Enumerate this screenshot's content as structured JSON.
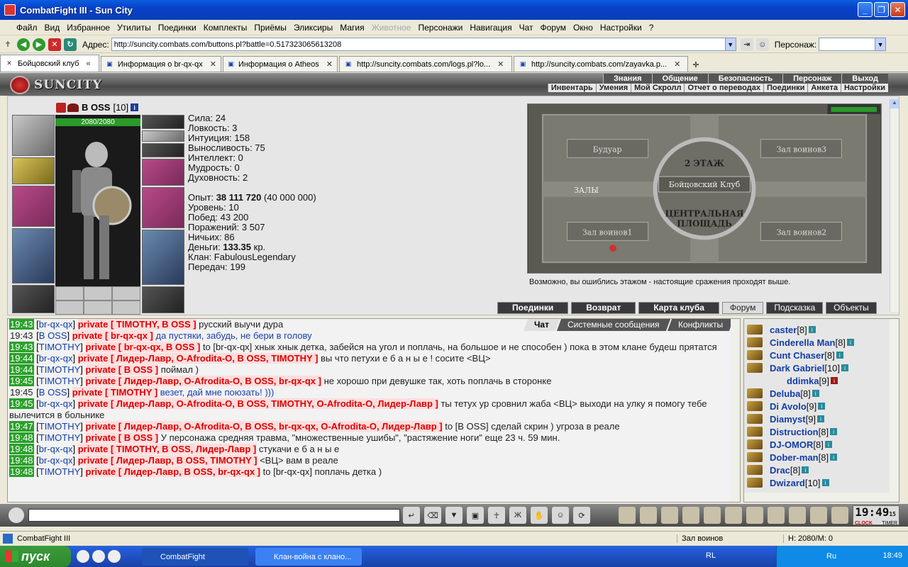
{
  "window": {
    "title": "CombatFight III - Sun City"
  },
  "menu": [
    "Файл",
    "Вид",
    "Избранное",
    "Утилиты",
    "Поединки",
    "Комплекты",
    "Приёмы",
    "Эликсиры",
    "Магия",
    "Животное",
    "Персонажи",
    "Навигация",
    "Чат",
    "Форум",
    "Окно",
    "Настройки",
    "?"
  ],
  "menu_disabled": [
    "Животное"
  ],
  "address": {
    "label": "Адрес:",
    "url": "http://suncity.combats.com/buttons.pl?battle=0.517323065613208",
    "persona_label": "Персонаж:"
  },
  "tabs": [
    {
      "label": "Бойцовский клуб",
      "active": true
    },
    {
      "label": "Информация о br-qx-qx",
      "active": false
    },
    {
      "label": "Информация о Atheos",
      "active": false
    },
    {
      "label": "http://suncity.combats.com/logs.pl?lo...",
      "active": false
    },
    {
      "label": "http://suncity.combats.com/zayavka.p...",
      "active": false
    }
  ],
  "game": {
    "logo": "SUNCITY",
    "nav_top": [
      "Знания",
      "Общение",
      "Безопасность",
      "Персонаж",
      "Выход"
    ],
    "nav_sub": [
      "Инвентарь",
      "Умения",
      "Мой Скролл",
      "Отчет о переводах",
      "Поединки",
      "Анкета",
      "Настройки"
    ]
  },
  "character": {
    "name": "B OSS",
    "level": "[10]",
    "hp": "2080/2080",
    "stats": [
      "Сила: 24",
      "Ловкость: 3",
      "Интуиция: 158",
      "Выносливость: 75",
      "Интеллект: 0",
      "Мудрость: 0",
      "Духовность: 2"
    ],
    "exp_label": "Опыт:",
    "exp_value": "38 111 720",
    "exp_next": "(40 000 000)",
    "level_line": "Уровень: 10",
    "wins": "Побед: 43 200",
    "losses": "Поражений: 3 507",
    "draws": "Ничьих: 86",
    "money_label": "Деньги:",
    "money_value": "133.35",
    "money_unit": "кр.",
    "clan": "Клан: FabulousLegendary",
    "transfers": "Передач: 199"
  },
  "map": {
    "rooms": [
      "Будуар",
      "Зал воинов3",
      "2 ЭТАЖ",
      "Бойцовский Клуб",
      "ЗАЛЫ",
      "ЦЕНТРАЛЬНАЯ",
      "ПЛОЩАДЬ",
      "Зал воинов1",
      "Зал воинов2"
    ],
    "hint": "Возможно, вы ошиблись этажом - настоящие сражения проходят выше."
  },
  "main_buttons": [
    "Поединки",
    "Возврат",
    "Карта клуба",
    "Форум",
    "Подсказка",
    "Объекты"
  ],
  "chat_tabs": [
    {
      "label": "Чат",
      "active": true
    },
    {
      "label": "Системные сообщения",
      "active": false
    },
    {
      "label": "Конфликты",
      "active": false
    }
  ],
  "chat": [
    {
      "time": "19:43",
      "timeStyle": "green",
      "user": "br-qx-qx",
      "priv": "private [ TIMOTHY, B OSS ]",
      "text": " русский выучи дура",
      "blue": false
    },
    {
      "time": "19:43",
      "timeStyle": "plain",
      "user": "B OSS",
      "priv": "private [ br-qx-qx ]",
      "text": " да пустяки, забудь, не бери в голову",
      "blue": true
    },
    {
      "time": "19:43",
      "timeStyle": "green",
      "user": "TIMOTHY",
      "priv": "private [ br-qx-qx, B OSS ]",
      "text": " to [br-qx-qx] хнык хнык детка, забейся на угол и поплачь, на большое и не способен ) пока в этом клане будеш прятатся",
      "blue": false
    },
    {
      "time": "19:44",
      "timeStyle": "green",
      "user": "br-qx-qx",
      "priv": "private [ Лидер-Лавр, O-Afrodita-O, B OSS, TIMOTHY ]",
      "text": " вы что петухи е б а н ы е ! сосите <ВЦ>",
      "blue": false
    },
    {
      "time": "19:44",
      "timeStyle": "green",
      "user": "TIMOTHY",
      "priv": "private [ B OSS ]",
      "text": " поймал )",
      "blue": false
    },
    {
      "time": "19:45",
      "timeStyle": "green",
      "user": "TIMOTHY",
      "priv": "private [ Лидер-Лавр, O-Afrodita-O, B OSS, br-qx-qx ]",
      "text": " не хорошо при девушке так, хоть поплачь в сторонке",
      "blue": false
    },
    {
      "time": "19:45",
      "timeStyle": "plain",
      "user": "B OSS",
      "priv": "private [ TIMOTHY ]",
      "text": " везет, дай мне поюзать! )))",
      "blue": true
    },
    {
      "time": "19:45",
      "timeStyle": "green",
      "user": "br-qx-qx",
      "priv": "private [ Лидер-Лавр, O-Afrodita-O, B OSS, TIMOTHY, O-Afrodita-O, Лидер-Лавр ]",
      "text": " ты тетух ур сровнил жаба <ВЦ> выходи на улку я помогу тебе вылечится в больнике",
      "blue": false
    },
    {
      "time": "19:47",
      "timeStyle": "green",
      "user": "TIMOTHY",
      "priv": "private [ Лидер-Лавр, O-Afrodita-O, B OSS, br-qx-qx, O-Afrodita-O, Лидер-Лавр ]",
      "text": " to [B OSS] сделай скрин ) угроза в реале",
      "blue": false
    },
    {
      "time": "19:48",
      "timeStyle": "green",
      "user": "TIMOTHY",
      "priv": "private [ B OSS ]",
      "text": " У персонажа средняя травма, \"множественные ушибы\", \"растяжение ноги\" еще 23 ч. 59 мин.",
      "blue": false
    },
    {
      "time": "19:48",
      "timeStyle": "green",
      "user": "br-qx-qx",
      "priv": "private [ TIMOTHY, B OSS, Лидер-Лавр ]",
      "text": " стукачи е б а н ы е",
      "blue": false
    },
    {
      "time": "19:48",
      "timeStyle": "green",
      "user": "br-qx-qx",
      "priv": "private [ Лидер-Лавр, B OSS, TIMOTHY ]",
      "text": " <ВЦ> вам в реале",
      "blue": false
    },
    {
      "time": "19:48",
      "timeStyle": "green",
      "user": "TIMOTHY",
      "priv": "private [ Лидер-Лавр, B OSS, br-qx-qx ]",
      "text": " to [br-qx-qx] поплачь детка )",
      "blue": false
    }
  ],
  "users": [
    {
      "name": "caster",
      "level": "[8]",
      "badge": "i",
      "indent": false
    },
    {
      "name": "Cinderella Man",
      "level": "[8]",
      "badge": "i",
      "indent": false
    },
    {
      "name": "Cunt Chaser",
      "level": "[8]",
      "badge": "i",
      "indent": false
    },
    {
      "name": "Dark Gabriel",
      "level": "[10]",
      "badge": "i",
      "indent": false
    },
    {
      "name": "ddimka",
      "level": "[9]",
      "badge": "i",
      "indent": true,
      "red": true
    },
    {
      "name": "Deluba",
      "level": "[8]",
      "badge": "i",
      "indent": false
    },
    {
      "name": "Di Avolo",
      "level": "[9]",
      "badge": "i",
      "indent": false
    },
    {
      "name": "Diamyst",
      "level": "[9]",
      "badge": "i",
      "indent": false
    },
    {
      "name": "Distruction",
      "level": "[8]",
      "badge": "i",
      "indent": false
    },
    {
      "name": "DJ-OMOR",
      "level": "[8]",
      "badge": "i",
      "indent": false
    },
    {
      "name": "Dober-man",
      "level": "[8]",
      "badge": "i",
      "indent": false
    },
    {
      "name": "Drac",
      "level": "[8]",
      "badge": "i",
      "indent": false
    },
    {
      "name": "Dwizard",
      "level": "[10]",
      "badge": "i",
      "indent": false
    }
  ],
  "clock": {
    "time": "19:49",
    "sec": "15",
    "labels": [
      "CLOCK",
      "TIMER"
    ]
  },
  "statusbar": {
    "text": "CombatFight III",
    "zone": "Зал воинов",
    "hp": "H: 2080/M: 0"
  },
  "taskbar": {
    "start": "пуск",
    "tasks": [
      "CombatFight",
      "Клан-война с клано..."
    ],
    "lang": "RL",
    "tray_lang": "Ru",
    "time": "18:49"
  }
}
